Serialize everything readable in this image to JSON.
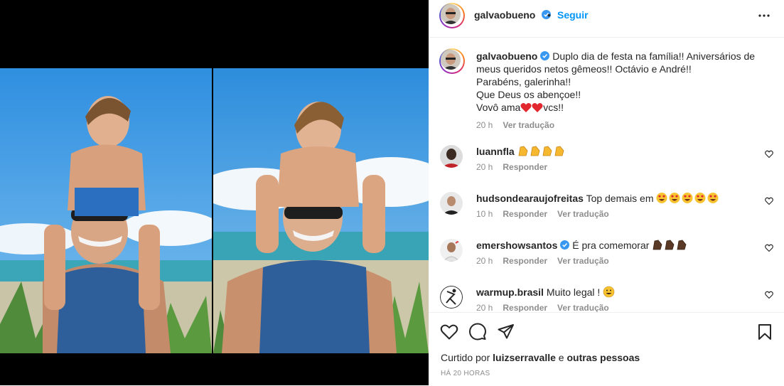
{
  "post": {
    "username": "galvaobueno",
    "follow_label": "Seguir",
    "separator": "•"
  },
  "caption": {
    "username": "galvaobueno",
    "line1": "Duplo dia de festa na família!! Aniversários de meus queridos netos gêmeos!! Octávio e André!!",
    "line2": "Parabéns, galerinha!!",
    "line3": "Que Deus os abençoe!!",
    "line4_a": "Vovô ama",
    "line4_b": "vcs!!",
    "time": "20 h",
    "translate": "Ver tradução"
  },
  "comments": [
    {
      "username": "luannfla",
      "text": "",
      "time": "20 h",
      "reply": "Responder",
      "translate": ""
    },
    {
      "username": "hudsondearaujofreitas",
      "text": "Top demais em",
      "time": "10 h",
      "reply": "Responder",
      "translate": "Ver tradução"
    },
    {
      "username": "emershowsantos",
      "text": "É pra comemorar",
      "time": "20 h",
      "reply": "Responder",
      "translate": "Ver tradução"
    },
    {
      "username": "warmup.brasil",
      "text": "Muito legal !",
      "time": "20 h",
      "reply": "Responder",
      "translate": "Ver tradução"
    }
  ],
  "footer": {
    "liked_prefix": "Curtido por",
    "liked_user": "luizserravalle",
    "liked_and": "e",
    "liked_others": "outras pessoas",
    "time_ago": "HÁ 20 HORAS"
  },
  "icons": [
    "verified-badge-icon",
    "more-options-icon",
    "heart-icon",
    "comment-icon",
    "share-icon",
    "bookmark-icon"
  ],
  "colors": {
    "accent": "#0095f6",
    "text": "#262626",
    "muted": "#8e8e8e"
  }
}
